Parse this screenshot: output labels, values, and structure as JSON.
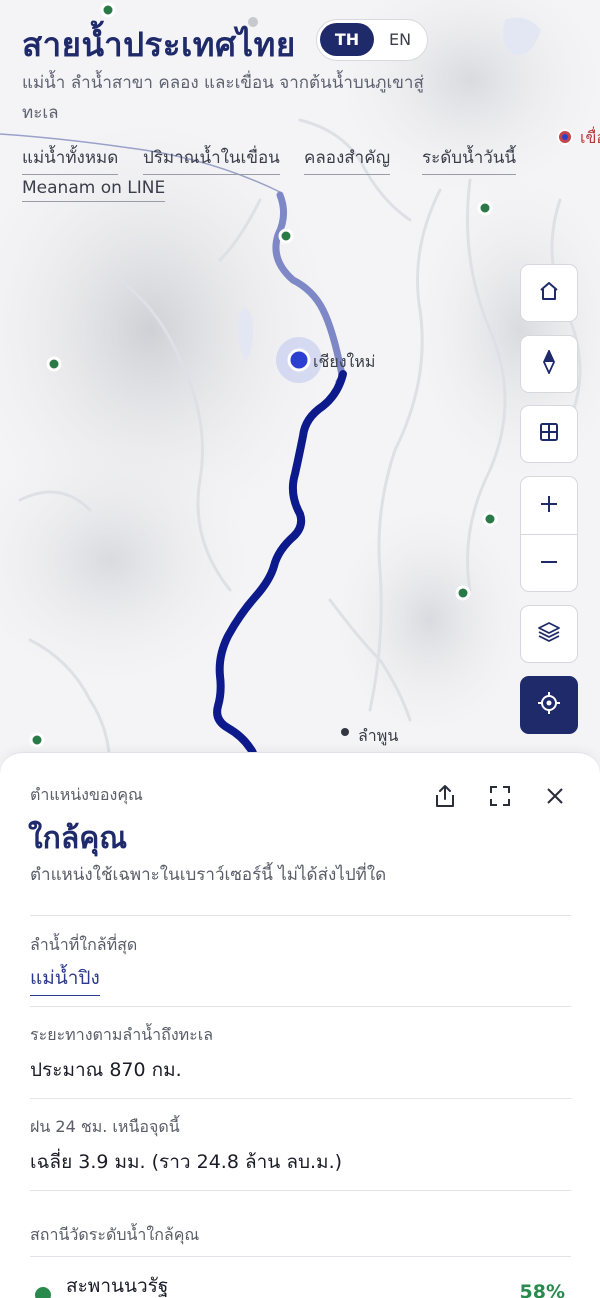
{
  "header": {
    "title": "สายน้ำประเทศไทย",
    "subtitle": "แม่น้ำ ลำน้ำสาขา คลอง และเขื่อน จากต้นน้ำบนภูเขาสู่ทะเล",
    "lang_toggle": {
      "th": "TH",
      "en": "EN",
      "selected": "TH"
    },
    "links": [
      "แม่น้ำทั้งหมด",
      "ปริมาณน้ำในเขื่อน",
      "คลองสำคัญ",
      "ระดับน้ำวันนี้",
      "Meanam on LINE"
    ]
  },
  "map": {
    "places": [
      {
        "name": "เชียงใหม่",
        "kind": "city-selected"
      },
      {
        "name": "ลำพูน",
        "kind": "town"
      }
    ],
    "edge_label": "เขื่อ",
    "river_color": "#0d1a8c",
    "upstream_color": "#7f88c6",
    "station_color": "#2a8a4e",
    "controls": [
      "home-icon",
      "compass-icon",
      "grid-icon",
      "plus-icon",
      "minus-icon",
      "layers-icon",
      "crosshair-icon"
    ]
  },
  "sheet": {
    "kicker": "ตำแหน่งของคุณ",
    "title": "ใกล้คุณ",
    "note": "ตำแหน่งใช้เฉพาะในเบราว์เซอร์นี้ ไม่ได้ส่งไปที่ใด",
    "nearest_river_label": "ลำน้ำที่ใกล้ที่สุด",
    "nearest_river_value": "แม่น้ำปิง",
    "distance_label": "ระยะทางตามลำน้ำถึงทะเล",
    "distance_value": "ประมาณ 870 กม.",
    "rain_label": "ฝน 24 ชม. เหนือจุดนี้",
    "rain_value": "เฉลี่ย 3.9 มม. (ราว 24.8 ล้าน ลบ.ม.)",
    "stations_label": "สถานีวัดระดับน้ำใกล้คุณ",
    "stations": [
      {
        "name": "สะพานนวรัฐ",
        "percent": "58%"
      }
    ],
    "actions": [
      "share-icon",
      "fullscreen-icon",
      "close-icon"
    ]
  }
}
